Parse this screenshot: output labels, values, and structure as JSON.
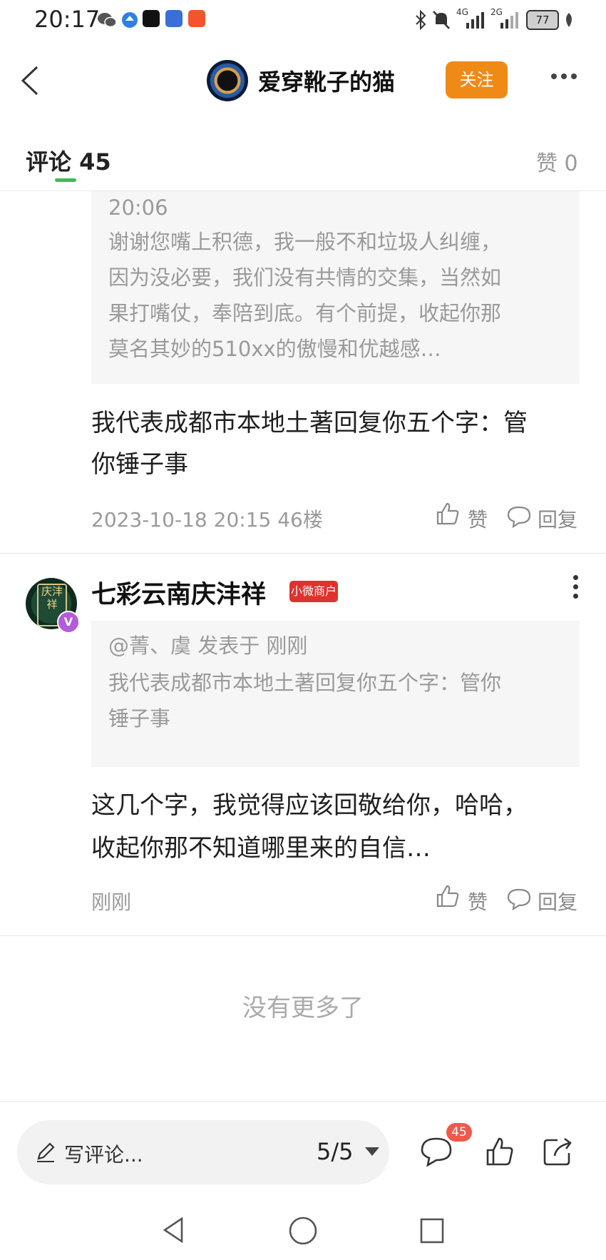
{
  "status_bar": {
    "time": "20:17",
    "signal_4g": "4G",
    "signal_2g": "2G",
    "battery": "77"
  },
  "header": {
    "author_name": "爱穿靴子的猫",
    "follow_label": "关注"
  },
  "tabs": {
    "comments_label": "评论",
    "comments_count": "45",
    "likes_label": "赞",
    "likes_count": "0"
  },
  "comments": [
    {
      "quote_time": "20:06",
      "quote_lines": [
        "谢谢您嘴上积德，我一般不和垃圾人纠缠，",
        "因为没必要，我们没有共情的交集，当然如",
        "果打嘴仗，奉陪到底。有个前提，收起你那",
        "莫名其妙的510xx的傲慢和优越感…"
      ],
      "content_lines": [
        "我代表成都市本地土著回复你五个字：管",
        "你锤子事"
      ],
      "meta": "2023-10-18 20:15  46楼",
      "like_label": "赞",
      "reply_label": "回复"
    },
    {
      "username": "七彩云南庆沣祥",
      "badge": "小微商户",
      "avatar_text": "庆沣祥",
      "verify_mark": "V",
      "quote_header": "@菁、虞 发表于 刚刚",
      "quote_lines": [
        "我代表成都市本地土著回复你五个字：管你",
        "锤子事"
      ],
      "content_lines": [
        "这几个字，我觉得应该回敬给你，哈哈，",
        "收起你那不知道哪里来的自信…"
      ],
      "meta": "刚刚",
      "like_label": "赞",
      "reply_label": "回复"
    }
  ],
  "no_more": "没有更多了",
  "bottom_bar": {
    "write_placeholder": "写评论...",
    "page_indicator": "5/5",
    "comment_count": "45"
  }
}
